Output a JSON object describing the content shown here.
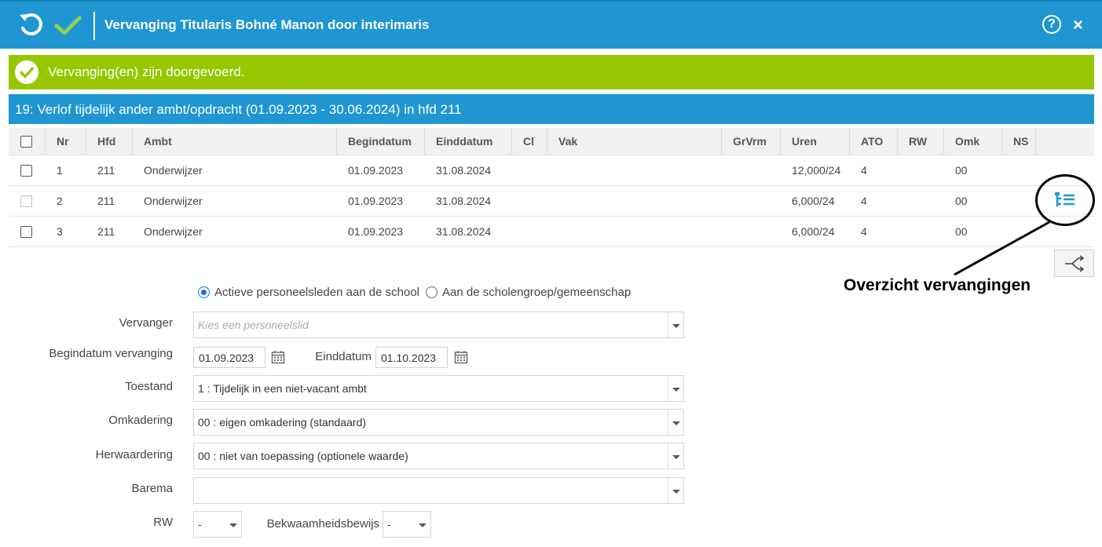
{
  "header": {
    "title": "Vervanging Titularis Bohné Manon door interimaris",
    "help_label": "?",
    "close_label": "×"
  },
  "colors": {
    "header_blue": "#1f96d2",
    "success_green": "#97c700",
    "accent_blue": "#1a73e8"
  },
  "alert": {
    "text": "Vervanging(en) zijn doorgevoerd."
  },
  "section": {
    "title": "19: Verlof tijdelijk ander ambt/opdracht (01.09.2023 - 30.06.2024) in hfd 211"
  },
  "table": {
    "columns": [
      "Nr",
      "Hfd",
      "Ambt",
      "Begindatum",
      "Einddatum",
      "Cl",
      "Vak",
      "GrVrm",
      "Uren",
      "ATO",
      "RW",
      "Omk",
      "NS"
    ],
    "rows": [
      {
        "nr": "1",
        "hfd": "211",
        "ambt": "Onderwijzer",
        "begindatum": "01.09.2023",
        "einddatum": "31.08.2024",
        "cl": "",
        "vak": "",
        "grvrm": "",
        "uren": "12,000/24",
        "ato": "4",
        "rw": "",
        "omk": "00",
        "ns": ""
      },
      {
        "nr": "2",
        "hfd": "211",
        "ambt": "Onderwijzer",
        "begindatum": "01.09.2023",
        "einddatum": "31.08.2024",
        "cl": "",
        "vak": "",
        "grvrm": "",
        "uren": "6,000/24",
        "ato": "4",
        "rw": "",
        "omk": "00",
        "ns": ""
      },
      {
        "nr": "3",
        "hfd": "211",
        "ambt": "Onderwijzer",
        "begindatum": "01.09.2023",
        "einddatum": "31.08.2024",
        "cl": "",
        "vak": "",
        "grvrm": "",
        "uren": "6,000/24",
        "ato": "4",
        "rw": "",
        "omk": "00",
        "ns": ""
      }
    ]
  },
  "annotation": {
    "label": "Overzicht vervangingen"
  },
  "form": {
    "radio_active": "Actieve personeelsleden aan de school",
    "radio_group": "Aan de scholengroep/gemeenschap",
    "vervanger_label": "Vervanger",
    "vervanger_placeholder": "Kies een personeelslid",
    "begindatum_label": "Begindatum vervanging",
    "begindatum_value": "01.09.2023",
    "einddatum_label": "Einddatum",
    "einddatum_value": "01.10.2023",
    "toestand_label": "Toestand",
    "toestand_value": "1 : Tijdelijk in een niet-vacant ambt",
    "omkadering_label": "Omkadering",
    "omkadering_value": "00 : eigen omkadering (standaard)",
    "herwaardering_label": "Herwaardering",
    "herwaardering_value": "00 : niet van toepassing (optionele waarde)",
    "barema_label": "Barema",
    "barema_value": "",
    "rw_label": "RW",
    "rw_value": "-",
    "bekwaamheid_label": "Bekwaamheidsbewijs",
    "bekwaamheid_value": "-"
  }
}
